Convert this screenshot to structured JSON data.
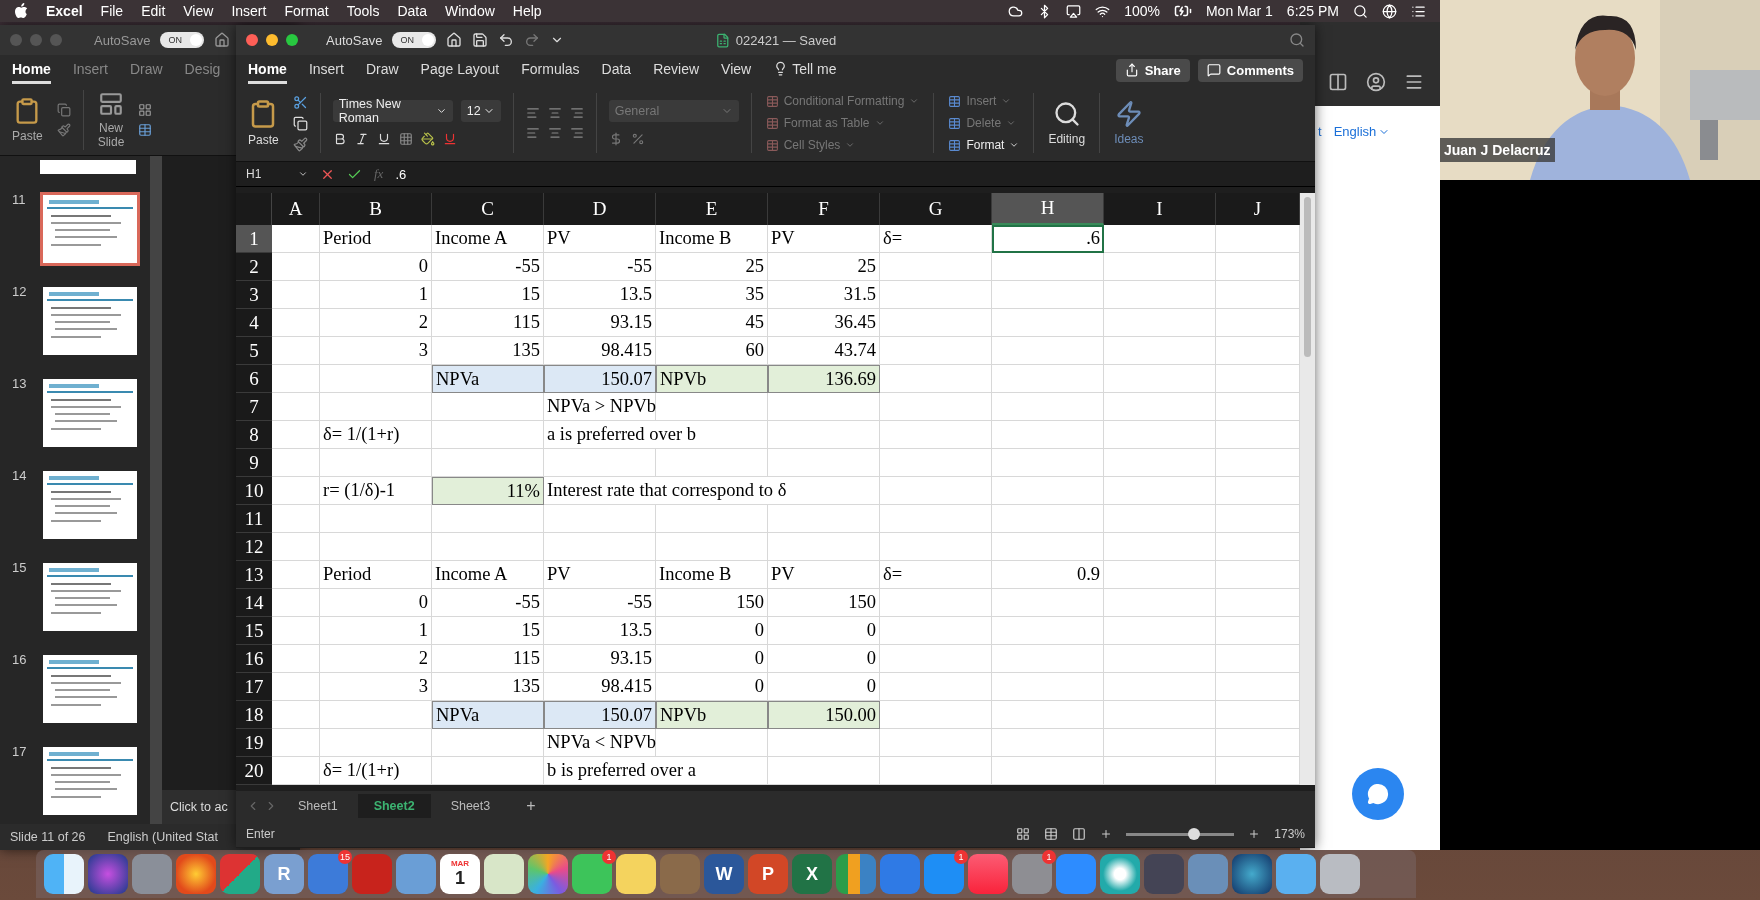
{
  "menu_bar": {
    "app": "Excel",
    "items": [
      "File",
      "Edit",
      "View",
      "Insert",
      "Format",
      "Tools",
      "Data",
      "Window",
      "Help"
    ],
    "battery": "100%",
    "date": "Mon Mar 1",
    "time": "6:25 PM"
  },
  "powerpoint": {
    "autosave": {
      "label": "AutoSave",
      "state": "ON",
      "on": true
    },
    "tabs": [
      {
        "label": "Home",
        "selected": true
      },
      {
        "label": "Insert",
        "selected": false
      },
      {
        "label": "Draw",
        "selected": false
      },
      {
        "label": "Desig",
        "selected": false
      }
    ],
    "ribbon": [
      "Paste",
      "New\nSlide"
    ],
    "slides": [
      {
        "number": "11",
        "selected": true
      },
      {
        "number": "12",
        "selected": false
      },
      {
        "number": "13",
        "selected": false
      },
      {
        "number": "14",
        "selected": false
      },
      {
        "number": "15",
        "selected": false
      },
      {
        "number": "16",
        "selected": false
      },
      {
        "number": "17",
        "selected": false
      }
    ],
    "notes_placeholder": "Click to ac",
    "status": [
      "Slide 11 of 26",
      "English (United Stat"
    ]
  },
  "excel": {
    "autosave": {
      "label": "AutoSave",
      "state": "ON",
      "on": true
    },
    "title": "022421 — Saved",
    "tabs": [
      {
        "label": "Home",
        "selected": true
      },
      {
        "label": "Insert",
        "selected": false
      },
      {
        "label": "Draw",
        "selected": false
      },
      {
        "label": "Page Layout",
        "selected": false
      },
      {
        "label": "Formulas",
        "selected": false
      },
      {
        "label": "Data",
        "selected": false
      },
      {
        "label": "Review",
        "selected": false
      },
      {
        "label": "View",
        "selected": false
      },
      {
        "label": "Tell me",
        "selected": false
      }
    ],
    "share": "Share",
    "comments": "Comments",
    "ribbon": {
      "paste": "Paste",
      "font": "Times New Roman",
      "size": "12",
      "number_format": {
        "value": "General",
        "disabled": true
      },
      "styles": [
        {
          "label": "Conditional Formatting",
          "disabled": true
        },
        {
          "label": "Format as Table",
          "disabled": true
        },
        {
          "label": "Cell Styles",
          "disabled": true
        }
      ],
      "cells": [
        {
          "label": "Insert",
          "disabled": true
        },
        {
          "label": "Delete",
          "disabled": true
        },
        {
          "label": "Format",
          "disabled": false
        }
      ],
      "editing": "Editing",
      "ideas": {
        "label": "Ideas",
        "disabled": true
      }
    },
    "formula_bar": {
      "name_box": "H1",
      "fx": "fx",
      "value": ".6"
    },
    "columns": [
      {
        "label": "A",
        "selected": false
      },
      {
        "label": "B",
        "selected": false
      },
      {
        "label": "C",
        "selected": false
      },
      {
        "label": "D",
        "selected": false
      },
      {
        "label": "E",
        "selected": false
      },
      {
        "label": "F",
        "selected": false
      },
      {
        "label": "G",
        "selected": false
      },
      {
        "label": "H",
        "selected": true
      },
      {
        "label": "I",
        "selected": false
      },
      {
        "label": "J",
        "selected": false
      }
    ],
    "rows": [
      {
        "label": "1",
        "selected": true,
        "cells": {
          "b": {
            "text": "Period"
          },
          "c": {
            "text": "Income A"
          },
          "d": {
            "text": "PV"
          },
          "e": {
            "text": "Income B"
          },
          "f": {
            "text": "PV"
          },
          "g": {
            "text": "δ="
          },
          "h": {
            "text": ".6",
            "kind": "number"
          }
        }
      },
      {
        "label": "2",
        "selected": false,
        "cells": {
          "b": {
            "text": "0",
            "kind": "number"
          },
          "c": {
            "text": "-55",
            "kind": "number"
          },
          "d": {
            "text": "-55",
            "kind": "number"
          },
          "e": {
            "text": "25",
            "kind": "number"
          },
          "f": {
            "text": "25",
            "kind": "number"
          }
        }
      },
      {
        "label": "3",
        "selected": false,
        "cells": {
          "b": {
            "text": "1",
            "kind": "number"
          },
          "c": {
            "text": "15",
            "kind": "number"
          },
          "d": {
            "text": "13.5",
            "kind": "number"
          },
          "e": {
            "text": "35",
            "kind": "number"
          },
          "f": {
            "text": "31.5",
            "kind": "number"
          }
        }
      },
      {
        "label": "4",
        "selected": false,
        "cells": {
          "b": {
            "text": "2",
            "kind": "number"
          },
          "c": {
            "text": "115",
            "kind": "number"
          },
          "d": {
            "text": "93.15",
            "kind": "number"
          },
          "e": {
            "text": "45",
            "kind": "number"
          },
          "f": {
            "text": "36.45",
            "kind": "number"
          }
        }
      },
      {
        "label": "5",
        "selected": false,
        "cells": {
          "b": {
            "text": "3",
            "kind": "number"
          },
          "c": {
            "text": "135",
            "kind": "number"
          },
          "d": {
            "text": "98.415",
            "kind": "number"
          },
          "e": {
            "text": "60",
            "kind": "number"
          },
          "f": {
            "text": "43.74",
            "kind": "number"
          }
        }
      },
      {
        "label": "6",
        "selected": false,
        "cells": {
          "c": {
            "text": "NPVa",
            "color": "#dce8f5"
          },
          "d": {
            "text": "150.07",
            "kind": "number",
            "color": "#dce8f5"
          },
          "e": {
            "text": "NPVb",
            "color": "#e2efd9"
          },
          "f": {
            "text": "136.69",
            "kind": "number",
            "color": "#e2efd9"
          }
        }
      },
      {
        "label": "7",
        "selected": false,
        "cells": {
          "d": {
            "text": "NPVa > NPVb"
          }
        }
      },
      {
        "label": "8",
        "selected": false,
        "cells": {
          "b": {
            "text": "δ= 1/(1+r)"
          },
          "d": {
            "text": "a is preferred over b"
          }
        }
      },
      {
        "label": "9",
        "selected": false
      },
      {
        "label": "10",
        "selected": false,
        "cells": {
          "b": {
            "text": "r=  (1/δ)-1"
          },
          "c": {
            "text": "11%",
            "kind": "number",
            "color": "#e2efd9"
          },
          "d": {
            "text": "Interest rate that correspond to δ"
          }
        }
      },
      {
        "label": "11",
        "selected": false
      },
      {
        "label": "12",
        "selected": false
      },
      {
        "label": "13",
        "selected": false,
        "cells": {
          "b": {
            "text": "Period"
          },
          "c": {
            "text": "Income A"
          },
          "d": {
            "text": "PV"
          },
          "e": {
            "text": "Income B"
          },
          "f": {
            "text": "PV"
          },
          "g": {
            "text": "δ="
          },
          "h": {
            "text": "0.9",
            "kind": "number"
          }
        }
      },
      {
        "label": "14",
        "selected": false,
        "cells": {
          "b": {
            "text": "0",
            "kind": "number"
          },
          "c": {
            "text": "-55",
            "kind": "number"
          },
          "d": {
            "text": "-55",
            "kind": "number"
          },
          "e": {
            "text": "150",
            "kind": "number"
          },
          "f": {
            "text": "150",
            "kind": "number"
          }
        }
      },
      {
        "label": "15",
        "selected": false,
        "cells": {
          "b": {
            "text": "1",
            "kind": "number"
          },
          "c": {
            "text": "15",
            "kind": "number"
          },
          "d": {
            "text": "13.5",
            "kind": "number"
          },
          "e": {
            "text": "0",
            "kind": "number"
          },
          "f": {
            "text": "0",
            "kind": "number"
          }
        }
      },
      {
        "label": "16",
        "selected": false,
        "cells": {
          "b": {
            "text": "2",
            "kind": "number"
          },
          "c": {
            "text": "115",
            "kind": "number"
          },
          "d": {
            "text": "93.15",
            "kind": "number"
          },
          "e": {
            "text": "0",
            "kind": "number"
          },
          "f": {
            "text": "0",
            "kind": "number"
          }
        }
      },
      {
        "label": "17",
        "selected": false,
        "cells": {
          "b": {
            "text": "3",
            "kind": "number"
          },
          "c": {
            "text": "135",
            "kind": "number"
          },
          "d": {
            "text": "98.415",
            "kind": "number"
          },
          "e": {
            "text": "0",
            "kind": "number"
          },
          "f": {
            "text": "0",
            "kind": "number"
          }
        }
      },
      {
        "label": "18",
        "selected": false,
        "cells": {
          "c": {
            "text": "NPVa",
            "color": "#dce8f5"
          },
          "d": {
            "text": "150.07",
            "kind": "number",
            "color": "#dce8f5"
          },
          "e": {
            "text": "NPVb",
            "color": "#e2efd9"
          },
          "f": {
            "text": "150.00",
            "kind": "number",
            "color": "#e2efd9"
          }
        }
      },
      {
        "label": "19",
        "selected": false,
        "cells": {
          "d": {
            "text": "NPVa < NPVb"
          }
        }
      },
      {
        "label": "20",
        "selected": false,
        "cells": {
          "b": {
            "text": "δ= 1/(1+r)"
          },
          "d": {
            "text": "b is preferred over a"
          }
        }
      }
    ],
    "sheets": [
      {
        "label": "Sheet1",
        "selected": false
      },
      {
        "label": "Sheet2",
        "selected": true
      },
      {
        "label": "Sheet3",
        "selected": false
      }
    ],
    "add_sheet": "+",
    "status": "Enter",
    "zoom": {
      "level": 0.63,
      "reading": "173%"
    }
  },
  "browser": {
    "link_fragment": "t",
    "language": "English"
  },
  "video": {
    "name": "Juan J Delacruz"
  },
  "dock": [
    {
      "kind": "finder"
    },
    {
      "kind": "siri"
    },
    {
      "kind": "rocket"
    },
    {
      "kind": "firefox"
    },
    {
      "kind": "shapes"
    },
    {
      "kind": "r",
      "glyph": "R"
    },
    {
      "kind": "grid",
      "badge": "15"
    },
    {
      "kind": "acrobat"
    },
    {
      "kind": "bird"
    },
    {
      "kind": "calendar",
      "label": "MAR",
      "glyph": "1"
    },
    {
      "kind": "map"
    },
    {
      "kind": "photos"
    },
    {
      "kind": "facetime",
      "badge": "1"
    },
    {
      "kind": "pencil"
    },
    {
      "kind": "books"
    },
    {
      "kind": "word",
      "glyph": "W"
    },
    {
      "kind": "powerpoint",
      "glyph": "P"
    },
    {
      "kind": "excel",
      "glyph": "X"
    },
    {
      "kind": "numbers"
    },
    {
      "kind": "keynote"
    },
    {
      "kind": "appstore",
      "badge": "1"
    },
    {
      "kind": "music"
    },
    {
      "kind": "settings",
      "badge": "1"
    },
    {
      "kind": "zoom"
    },
    {
      "kind": "sphere"
    },
    {
      "kind": "screen"
    },
    {
      "kind": "preview"
    },
    {
      "kind": "globe"
    },
    {
      "kind": "folder"
    },
    {
      "kind": "trash"
    }
  ]
}
